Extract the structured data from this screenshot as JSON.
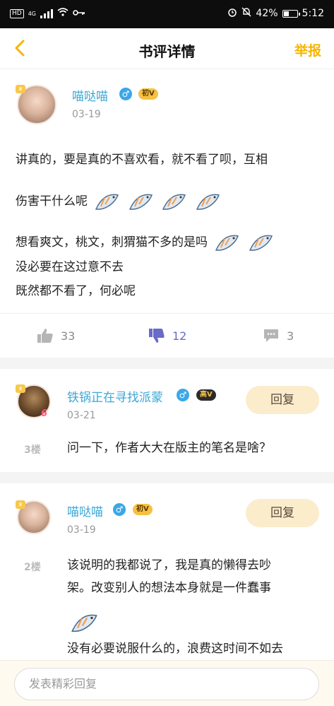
{
  "status": {
    "network": "4G",
    "battery": "42%",
    "time": "5:12",
    "hd": "HD",
    "battery_level": 0.42
  },
  "header": {
    "title": "书评详情",
    "report": "举报"
  },
  "post": {
    "user": "喵哒喵",
    "gender_icon": "male-icon",
    "vip": "初V",
    "date": "03-19",
    "lines": [
      "讲真的，要是真的不喜欢看，就不看了呗，互相",
      "伤害干什么呢",
      "想看爽文，桃文，刺猬猫不多的是吗",
      "没必要在这过意不去",
      "既然都不看了，何必呢"
    ],
    "likes": "33",
    "dislikes": "12",
    "comments": "3"
  },
  "replies": [
    {
      "floor": "3楼",
      "user": "铁锅正在寻找派蒙",
      "vip": "高V",
      "date": "03-21",
      "lines": [
        "问一下，作者大大在版主的笔名是啥？"
      ],
      "button": "回复",
      "level": "6"
    },
    {
      "floor": "2楼",
      "user": "喵哒喵",
      "vip": "初V",
      "date": "03-19",
      "lines": [
        "该说明的我都说了，我是真的懒得去吵",
        "架。改变别人的想法本身就是一件蠢事",
        "没有必要说服什么的，浪费这时间不如去"
      ],
      "button": "回复"
    }
  ],
  "input": {
    "placeholder": "发表精彩回复"
  },
  "colors": {
    "accent": "#f7b500",
    "username": "#3ba7d7",
    "dislike_active": "#6a6ac9"
  }
}
